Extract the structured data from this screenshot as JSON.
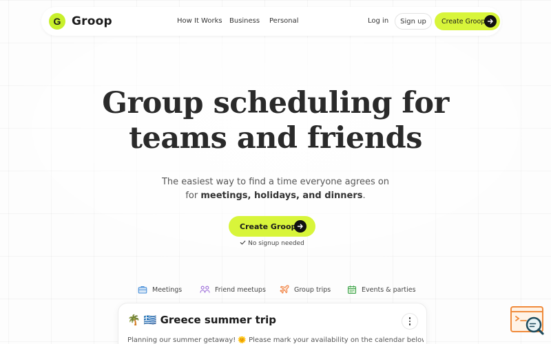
{
  "brand": {
    "logo_letter": "G",
    "name": "Groop",
    "accent_color": "#d8f53a"
  },
  "nav": {
    "links": [
      "How It Works",
      "Business",
      "Personal"
    ],
    "login": "Log in",
    "signup": "Sign up",
    "cta": "Create Groop"
  },
  "hero": {
    "title_line1": "Group scheduling for",
    "title_line2": "teams and friends",
    "subtitle_line1": "The easiest way to find a time everyone agrees on",
    "subtitle_prefix": "for ",
    "subtitle_bold": "meetings, holidays, and dinners",
    "subtitle_suffix": ".",
    "cta": "Create Groop",
    "no_signup": "No signup needed"
  },
  "categories": [
    {
      "label": "Meetings",
      "icon": "briefcase-icon"
    },
    {
      "label": "Friend meetups",
      "icon": "people-icon"
    },
    {
      "label": "Group trips",
      "icon": "airplane-icon"
    },
    {
      "label": "Events & parties",
      "icon": "calendar-icon"
    }
  ],
  "card": {
    "emoji": "🌴 🇬🇷",
    "title": "Greece summer trip",
    "description": "Planning our summer getaway! 🌞 Please mark your availability on the calendar below. The"
  },
  "widget": {
    "icon": "search-window-icon"
  }
}
